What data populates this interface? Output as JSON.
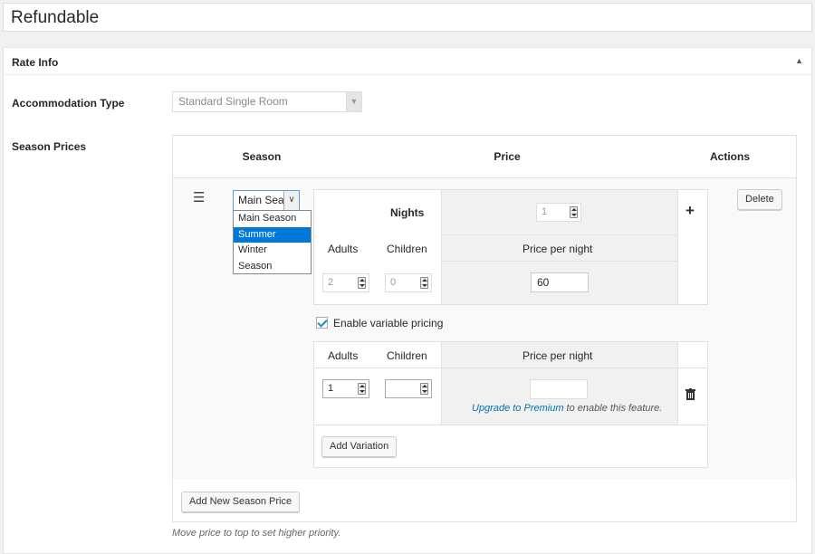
{
  "post_title": "Refundable",
  "panel": {
    "title": "Rate Info",
    "toggle_icon": "▲",
    "accommodation_label": "Accommodation Type",
    "accommodation_value": "Standard Single Room",
    "season_prices_label": "Season Prices"
  },
  "season_table": {
    "headers": {
      "season": "Season",
      "price": "Price",
      "actions": "Actions"
    },
    "season_select": {
      "value": "Main Seas",
      "options": [
        "Main Season",
        "Summer",
        "Winter",
        "Season"
      ],
      "highlighted": "Summer"
    },
    "nights_label": "Nights",
    "nights_value": "1",
    "adults_label": "Adults",
    "children_label": "Children",
    "price_per_night_label": "Price per night",
    "base_adults": "2",
    "base_children": "0",
    "base_price": "60",
    "delete_label": "Delete",
    "enable_variable_label": "Enable variable pricing",
    "variation": {
      "adults_label": "Adults",
      "children_label": "Children",
      "price_per_night_label": "Price per night",
      "adults_value": "1",
      "children_value": "",
      "upgrade_link": "Upgrade to Premium",
      "upgrade_text": " to enable this feature."
    },
    "add_variation_label": "Add Variation",
    "add_season_label": "Add New Season Price"
  },
  "footer_note": "Move price to top to set higher priority."
}
